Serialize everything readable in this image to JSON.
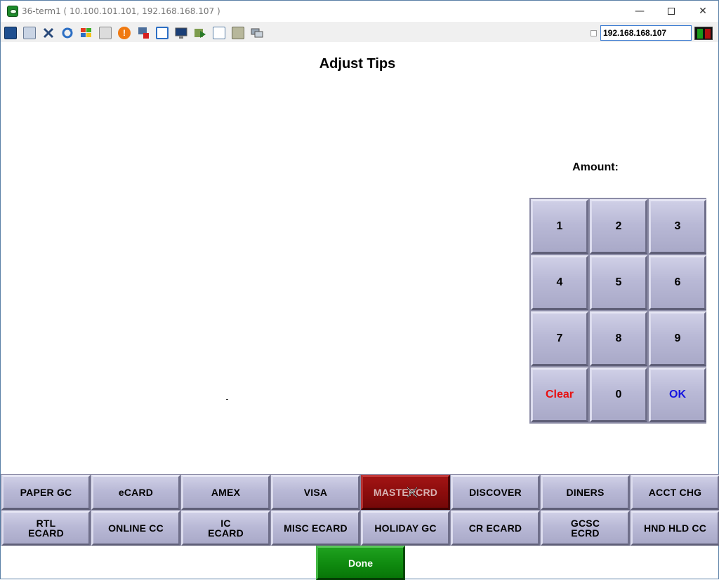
{
  "window": {
    "title": "36-term1 ( 10.100.101.101, 192.168.168.107 )",
    "controls": {
      "minimize": "—",
      "close": "✕"
    }
  },
  "toolbar": {
    "icons": [
      "monitor-icon",
      "windows-icon",
      "tools-icon",
      "refresh-icon",
      "flag-icon",
      "keyboard-icon",
      "alert-icon",
      "disconnect-icon",
      "fullscreen-icon",
      "display-icon",
      "download-icon",
      "document-icon",
      "map-icon",
      "chat-icon"
    ],
    "ip_address": "192.168.168.107"
  },
  "screen": {
    "title": "Adjust Tips",
    "amount_label": "Amount:"
  },
  "keypad": {
    "keys": [
      "1",
      "2",
      "3",
      "4",
      "5",
      "6",
      "7",
      "8",
      "9",
      "Clear",
      "0",
      "OK"
    ]
  },
  "tenders": [
    [
      "PAPER GC",
      "eCARD",
      "AMEX",
      "VISA",
      "MASTERCRD",
      "DISCOVER",
      "DINERS",
      "ACCT CHG"
    ],
    [
      "RTL\nECARD",
      "ONLINE CC",
      "IC\nECARD",
      "MISC ECARD",
      "HOLIDAY GC",
      "CR ECARD",
      "GCSC\nECRD",
      "HND HLD CC"
    ]
  ],
  "selected_tender": "MASTERCRD",
  "done_label": "Done",
  "colors": {
    "button_face": "#b9b9d6",
    "selected_button": "#8a0c0c",
    "clear_text": "#e81010",
    "ok_text": "#1515e0",
    "done_button": "#0f8a0f"
  }
}
